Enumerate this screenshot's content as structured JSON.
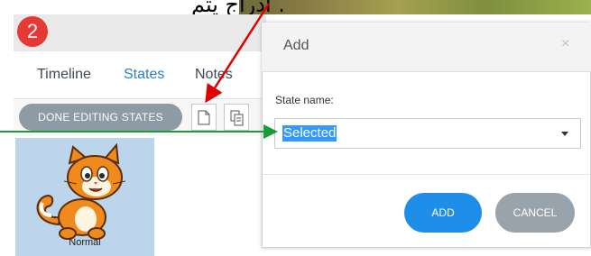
{
  "banner": {
    "text": "ادراج يتم ."
  },
  "step_badge": "2",
  "tabs": [
    {
      "label": "Timeline",
      "active": false
    },
    {
      "label": "States",
      "active": true
    },
    {
      "label": "Notes",
      "active": false
    }
  ],
  "toolbar": {
    "done_label": "DONE EDITING STATES",
    "icons": [
      "new-state-icon",
      "duplicate-state-icon"
    ]
  },
  "states": [
    {
      "label": "Normal",
      "image": "cartoon-cat"
    }
  ],
  "dialog": {
    "title": "Add",
    "close_glyph": "×",
    "field_label": "State name:",
    "selected_value": "Selected",
    "add_label": "ADD",
    "cancel_label": "CANCEL"
  },
  "colors": {
    "accent": "#1e8ee8",
    "badge": "#e53935",
    "annotation_red": "#e00000",
    "annotation_green": "#1a9c3a",
    "selection": "#3399ff"
  }
}
